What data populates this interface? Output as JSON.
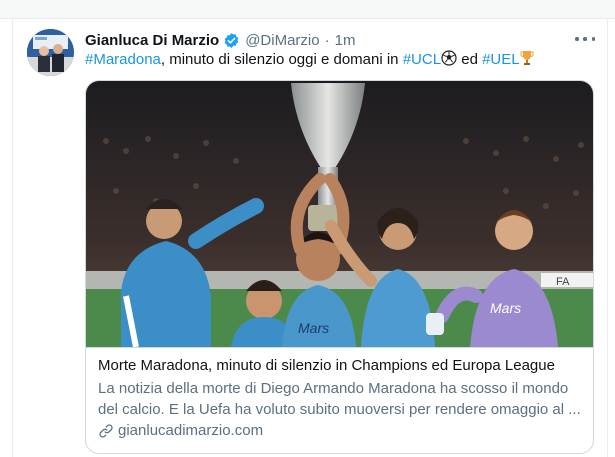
{
  "tweet": {
    "author_name": "Gianluca Di Marzio",
    "handle": "@DiMarzio",
    "separator": "·",
    "time": "1m",
    "text_parts": {
      "hashtag_1": "#Maradona",
      "middle": ", minuto di silenzio oggi e domani in ",
      "hashtag_2": "#UCL",
      "emoji_1": "⚽",
      "between": " ed ",
      "hashtag_3": "#UEL",
      "emoji_2": "🏆"
    }
  },
  "card": {
    "title": "Morte Maradona, minuto di silenzio in Champions ed Europa League",
    "description": "La notizia della morte di Diego Armando Maradona ha scosso il mondo del calcio. E la Uefa ha voluto subito muoversi per rendere omaggio al ...",
    "domain": "gianlucadimarzio.com"
  },
  "icons": {
    "verified": "verified-badge-icon",
    "more": "more-options-icon",
    "link": "link-icon"
  },
  "colors": {
    "link": "#1b95e0",
    "secondary_text": "#5b7083",
    "verified": "#1da1f2",
    "border": "#cfd9de"
  }
}
